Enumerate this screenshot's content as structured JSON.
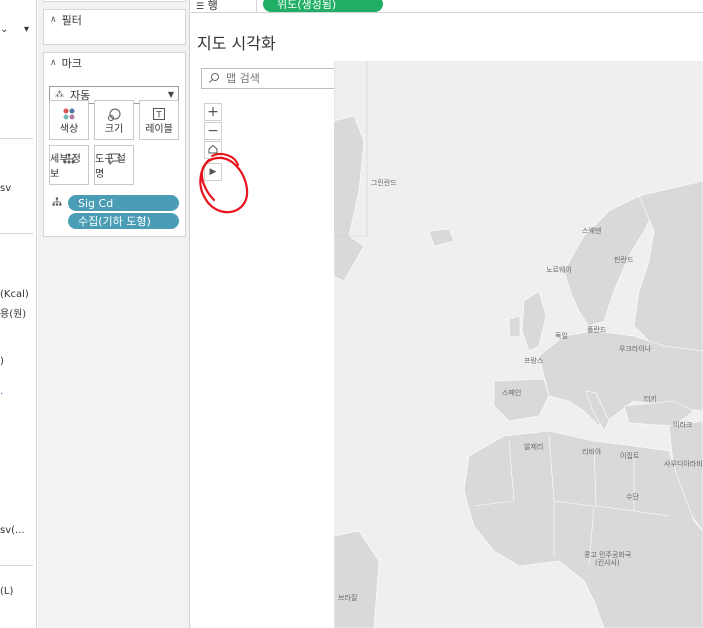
{
  "data_pane": {
    "fragments": [
      "sv",
      "(Kcal)",
      "용(원)",
      ")",
      "sv(...",
      "(L)"
    ]
  },
  "filters_card": {
    "title": "필터"
  },
  "marks_card": {
    "title": "마크",
    "mark_type": "자동",
    "buttons": {
      "color": "색상",
      "size": "크기",
      "label": "레이블",
      "detail": "세부 정보",
      "tooltip": "도구 설명"
    },
    "pills": [
      "Sig Cd",
      "수집(기하 도형)"
    ]
  },
  "shelf": {
    "rows_label": "행",
    "rows_pill": "위도(생성됨)"
  },
  "view": {
    "title": "지도 시각화",
    "search_placeholder": "맵 검색"
  },
  "map_labels": {
    "greenland": "그린란드",
    "sweden": "스웨덴",
    "finland": "핀란드",
    "norway": "노르웨이",
    "germany": "독일",
    "poland": "폴란드",
    "ukraine": "우크라이나",
    "france": "프랑스",
    "spain": "스페인",
    "turkey": "터키",
    "iraq": "이라크",
    "algeria": "알제리",
    "libya": "리비아",
    "egypt": "이집트",
    "saudi": "사우디아라비아",
    "sudan": "수단",
    "drc": "콩고 민주공화국",
    "drc2": "(킨샤사)",
    "brazil": "브라질"
  },
  "colors": {
    "pill_teal": "#4a9db5",
    "pill_green": "#1fae64",
    "map_bg": "#efefef",
    "land": "#d9d9d9",
    "annotation": "#e8141c"
  }
}
